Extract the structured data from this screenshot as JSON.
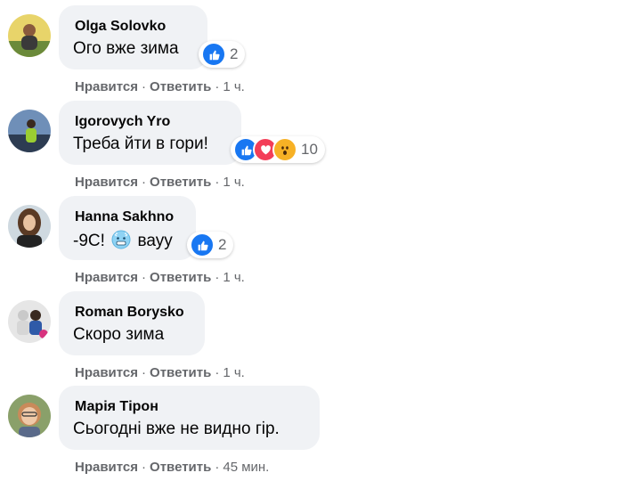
{
  "comments": [
    {
      "author": "Olga Solovko",
      "text": "Ого вже зима",
      "reactions": [
        "like"
      ],
      "reaction_count": "2",
      "like_label": "Нравится",
      "reply_label": "Ответить",
      "time": "1 ч."
    },
    {
      "author": "Igorovych Yro",
      "text": "Треба йти в гори!",
      "reactions": [
        "like",
        "love",
        "wow"
      ],
      "reaction_count": "10",
      "like_label": "Нравится",
      "reply_label": "Ответить",
      "time": "1 ч."
    },
    {
      "author": "Hanna Sakhno",
      "text_before": "-9С!",
      "text_emoji": "cold-face-emoji",
      "text_after": "вауу",
      "reactions": [
        "like"
      ],
      "reaction_count": "2",
      "like_label": "Нравится",
      "reply_label": "Ответить",
      "time": "1 ч."
    },
    {
      "author": "Roman Borysko",
      "text": "Скоро зима",
      "like_label": "Нравится",
      "reply_label": "Ответить",
      "time": "1 ч."
    },
    {
      "author": "Марія Тірон",
      "text": "Сьогодні вже не видно гір.",
      "like_label": "Нравится",
      "reply_label": "Ответить",
      "time": "45 мин."
    }
  ],
  "separator": "·",
  "colors": {
    "bubble": "#f0f2f5",
    "meta": "#65676b",
    "like": "#1877f2",
    "love": "#f33e58",
    "wow": "#f7b125"
  }
}
